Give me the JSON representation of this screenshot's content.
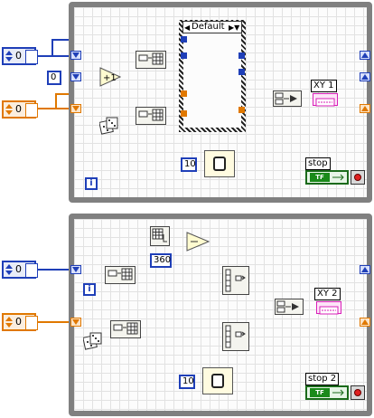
{
  "loop1": {
    "case_selector": "Default",
    "controls": [
      {
        "value": "0",
        "style": "blue"
      },
      {
        "value": "0",
        "style": "orange"
      }
    ],
    "shift_init": "0",
    "wait_constant": "10",
    "iteration_label": "i",
    "graph_label": "XY 1",
    "stop_label": "stop",
    "stop_button_text": "TF"
  },
  "loop2": {
    "controls": [
      {
        "value": "0",
        "style": "blue"
      },
      {
        "value": "0",
        "style": "orange"
      }
    ],
    "modulo_constant": "360",
    "wait_constant": "10",
    "iteration_label": "i",
    "graph_label": "XY 2",
    "stop_label": "stop 2",
    "stop_button_text": "TF"
  },
  "colors": {
    "numeric": "#1f3fb8",
    "array": "#e07800",
    "boolean": "#1a8a1a",
    "graph": "#d81fb8",
    "frame": "#808080"
  }
}
